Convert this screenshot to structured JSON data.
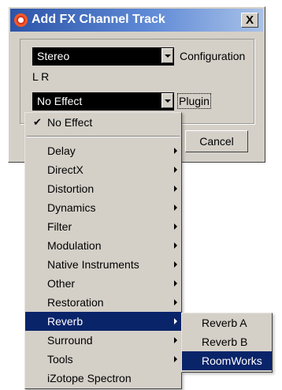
{
  "dialog": {
    "title": "Add FX Channel Track",
    "close_label": "X",
    "configuration": {
      "value": "Stereo",
      "label": "Configuration"
    },
    "channels_text": "L R",
    "plugin": {
      "value": "No Effect",
      "label": "Plugin"
    },
    "cancel_label": "Cancel"
  },
  "plugin_menu": {
    "items": [
      {
        "label": "No Effect",
        "checked": true
      },
      {
        "label": "Delay",
        "submenu": true
      },
      {
        "label": "DirectX",
        "submenu": true
      },
      {
        "label": "Distortion",
        "submenu": true
      },
      {
        "label": "Dynamics",
        "submenu": true
      },
      {
        "label": "Filter",
        "submenu": true
      },
      {
        "label": "Modulation",
        "submenu": true
      },
      {
        "label": "Native Instruments",
        "submenu": true
      },
      {
        "label": "Other",
        "submenu": true
      },
      {
        "label": "Restoration",
        "submenu": true
      },
      {
        "label": "Reverb",
        "submenu": true,
        "highlighted": true
      },
      {
        "label": "Surround",
        "submenu": true
      },
      {
        "label": "Tools",
        "submenu": true
      },
      {
        "label": "iZotope Spectron"
      }
    ],
    "check_glyph": "✔"
  },
  "reverb_submenu": {
    "items": [
      {
        "label": "Reverb A"
      },
      {
        "label": "Reverb B"
      },
      {
        "label": "RoomWorks",
        "highlighted": true
      }
    ]
  },
  "colors": {
    "dialog_face": "#d4d0c8",
    "titlebar_start": "#2c54a8",
    "highlight": "#0a246a",
    "select_bg": "#000000"
  }
}
